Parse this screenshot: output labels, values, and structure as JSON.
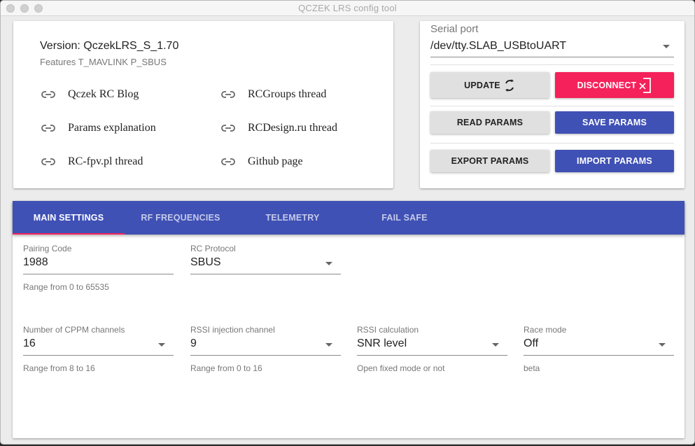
{
  "window": {
    "title": "QCZEK LRS config tool"
  },
  "info": {
    "version": "Version: QczekLRS_S_1.70",
    "features": "Features T_MAVLINK P_SBUS",
    "links": [
      {
        "label": "Qczek RC Blog",
        "icon": "link-icon"
      },
      {
        "label": "RCGroups thread",
        "icon": "link-icon"
      },
      {
        "label": "Params explanation",
        "icon": "link-icon"
      },
      {
        "label": "RCDesign.ru thread",
        "icon": "link-icon"
      },
      {
        "label": "RC-fpv.pl thread",
        "icon": "link-icon"
      },
      {
        "label": "Github page",
        "icon": "link-icon"
      }
    ]
  },
  "serial": {
    "label": "Serial port",
    "value": "/dev/tty.SLAB_USBtoUART",
    "buttons": {
      "update": "UPDATE",
      "disconnect": "DISCONNECT",
      "read": "READ PARAMS",
      "save": "SAVE PARAMS",
      "export": "EXPORT PARAMS",
      "import": "IMPORT PARAMS"
    }
  },
  "tabs": [
    {
      "label": "MAIN SETTINGS",
      "active": true
    },
    {
      "label": "RF FREQUENCIES",
      "active": false
    },
    {
      "label": "TELEMETRY",
      "active": false
    },
    {
      "label": "FAIL SAFE",
      "active": false
    }
  ],
  "main_settings": {
    "pairing_code": {
      "label": "Pairing Code",
      "value": "1988",
      "help": "Range from 0 to 65535"
    },
    "rc_protocol": {
      "label": "RC Protocol",
      "value": "SBUS",
      "help": ""
    },
    "cppm_channels": {
      "label": "Number of CPPM channels",
      "value": "16",
      "help": "Range from 8 to 16"
    },
    "rssi_channel": {
      "label": "RSSI injection channel",
      "value": "9",
      "help": "Range from 0 to 16"
    },
    "rssi_calc": {
      "label": "RSSI calculation",
      "value": "SNR level",
      "help": "Open fixed mode or not"
    },
    "race_mode": {
      "label": "Race mode",
      "value": "Off",
      "help": "beta"
    }
  },
  "colors": {
    "primary": "#3f51b5",
    "accent": "#f5215a",
    "button_grey": "#e0e0e0"
  }
}
